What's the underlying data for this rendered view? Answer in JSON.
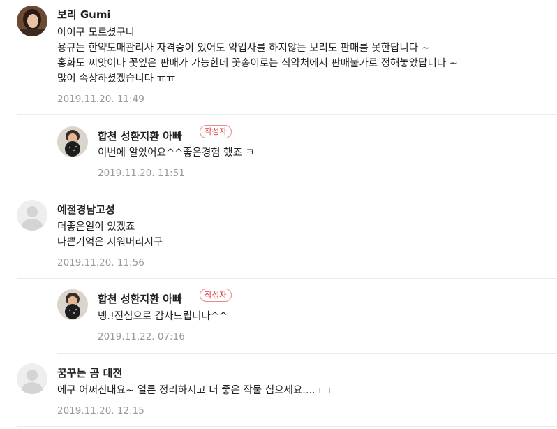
{
  "comments": [
    {
      "author": "보리 Gumi",
      "lines": [
        "아이구 모르셨구나",
        "용규는 한약도매관리사 자격증이 있어도 약업사를 하지않는 보리도 판매를 못한답니다 ~",
        "홍화도 씨앗이나 꽃잎은 판매가 가능한데 꽃송이로는 식약처에서 판매불가로 정해놓았답니다 ~",
        "많이 속상하셨겠습니다 ㅠㅠ"
      ],
      "time": "2019.11.20. 11:49"
    },
    {
      "author": "합천 성환지환 아빠",
      "badge": "작성자",
      "lines": [
        "이번에 알았어요^^좋은경험 했죠 ㅋ"
      ],
      "time": "2019.11.20. 11:51"
    },
    {
      "author": "예절경남고성",
      "lines": [
        "더좋은일이 있겠죠",
        "나쁜기억은 지워버리시구"
      ],
      "time": "2019.11.20. 11:56"
    },
    {
      "author": "합천 성환지환 아빠",
      "badge": "작성자",
      "lines": [
        "넹.!진심으로 감사드립니다^^"
      ],
      "time": "2019.11.22. 07:16"
    },
    {
      "author": "꿈꾸는 곰 대전",
      "lines": [
        "에구 어쩌신대요~ 얼른 정리하시고 더 좋은 작물 심으세요....ㅜㅜ"
      ],
      "time": "2019.11.20. 12:15"
    }
  ],
  "colors": {
    "badge": "#e0343b",
    "timestamp": "#999999",
    "divider": "#ececec"
  }
}
